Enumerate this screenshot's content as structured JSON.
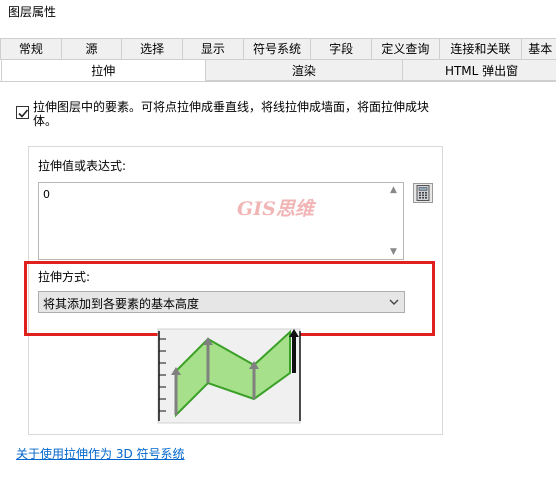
{
  "window": {
    "title": "图层属性"
  },
  "tabs_top": [
    "常规",
    "源",
    "选择",
    "显示",
    "符号系统",
    "字段",
    "定义查询",
    "连接和关联",
    "基本"
  ],
  "tabs_second": [
    {
      "label": "拉伸",
      "active": true
    },
    {
      "label": "渲染",
      "active": false
    },
    {
      "label": "HTML 弹出窗",
      "active": false
    }
  ],
  "extrude": {
    "checkbox_checked": true,
    "checkbox_label": "拉伸图层中的要素。可将点拉伸成垂直线，将线拉伸成墙面，将面拉伸成块体。",
    "value_label": "拉伸值或表达式:",
    "value": "0",
    "method_label": "拉伸方式:",
    "method_selected": "将其添加到各要素的基本高度",
    "help_link": "关于使用拉伸作为 3D 符号系统"
  },
  "watermark_text": "GIS思维",
  "colors": {
    "highlight_border": "#e0201c",
    "link": "#0066cc",
    "preview_fill": "#a6e08a",
    "preview_stroke": "#3aa028"
  },
  "icons": {
    "calculator": "calculator-icon",
    "dropdown": "chevron-down-icon",
    "check": "check-icon"
  }
}
